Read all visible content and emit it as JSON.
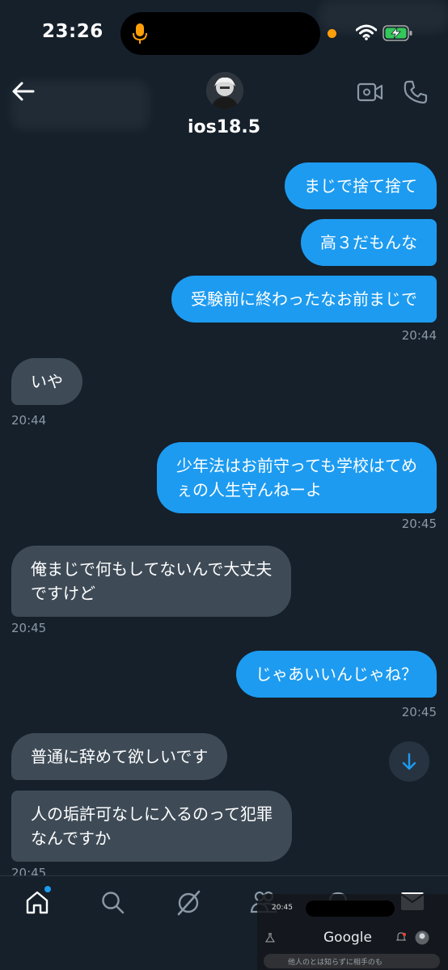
{
  "status_bar": {
    "time": "23:26"
  },
  "header": {
    "name": "ios18.5"
  },
  "messages": [
    {
      "text": "まじで捨て捨て"
    },
    {
      "text": "高３だもんな"
    },
    {
      "text": "受験前に終わったなお前まじで"
    },
    {
      "time": "20:44"
    },
    {
      "text": "いや"
    },
    {
      "time": "20:44"
    },
    {
      "line1": "少年法はお前守っても学校はてめ",
      "line2": "ぇの人生守んねーよ"
    },
    {
      "time": "20:45"
    },
    {
      "line1": "俺まじで何もしてないんで大丈夫",
      "line2": "ですけど"
    },
    {
      "time": "20:45"
    },
    {
      "text": "じゃあいいんじゃね？"
    },
    {
      "time": "20:45"
    },
    {
      "text": "普通に辞めて欲しいです"
    },
    {
      "line1": "人の垢許可なしに入るのって犯罪",
      "line2": "なんですか"
    },
    {
      "time": "20:45"
    }
  ],
  "pip": {
    "time": "20:45",
    "brand": "Google",
    "search_placeholder": "他人のとは知らずに相手のも"
  },
  "colors": {
    "sent": "#1d9bf0",
    "received": "#3e4b57",
    "background": "#15202b"
  }
}
